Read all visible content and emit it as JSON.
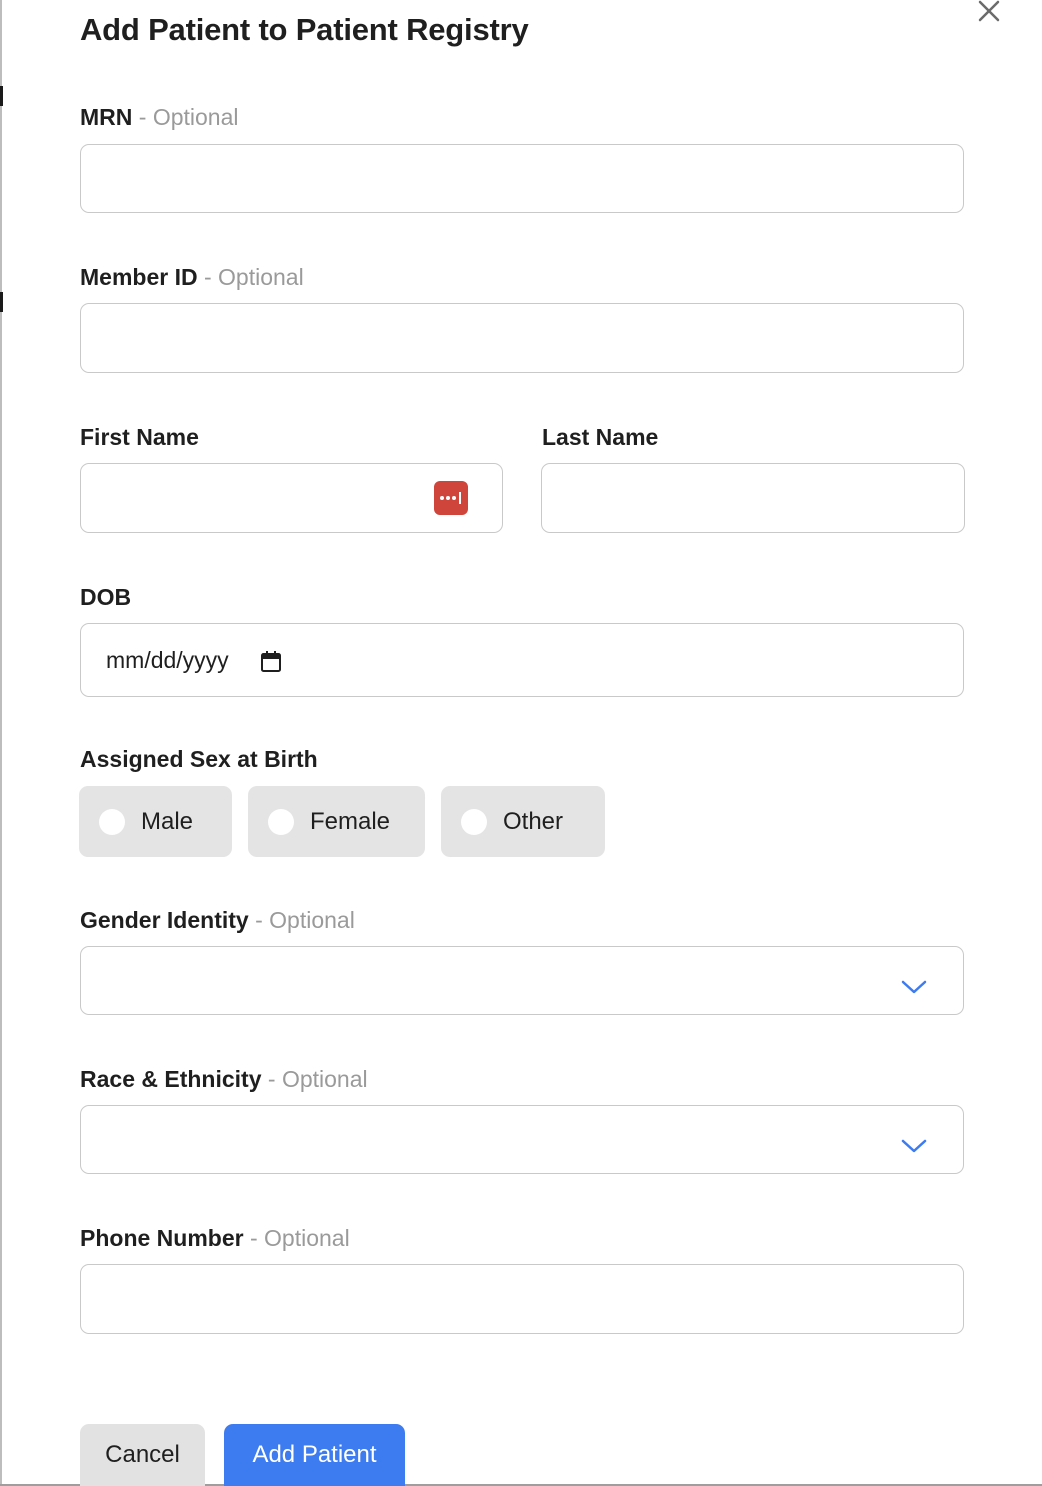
{
  "dialog": {
    "title": "Add Patient to Patient Registry",
    "close_icon": "close-icon"
  },
  "fields": {
    "optional_suffix": "- Optional",
    "mrn": {
      "label": "MRN",
      "value": ""
    },
    "member_id": {
      "label": "Member ID",
      "value": ""
    },
    "first_name": {
      "label": "First Name",
      "value": "",
      "autofill_icon": "password-manager-icon"
    },
    "last_name": {
      "label": "Last Name",
      "value": ""
    },
    "dob": {
      "label": "DOB",
      "placeholder": "mm/dd/yyyy",
      "icon": "calendar-icon"
    },
    "sex_at_birth": {
      "label": "Assigned Sex at Birth",
      "options": [
        "Male",
        "Female",
        "Other"
      ],
      "selected": null
    },
    "gender_identity": {
      "label": "Gender Identity",
      "value": "",
      "icon": "chevron-down-icon"
    },
    "race_ethnicity": {
      "label": "Race & Ethnicity",
      "value": "",
      "icon": "chevron-down-icon"
    },
    "phone": {
      "label": "Phone Number",
      "value": ""
    }
  },
  "actions": {
    "cancel_label": "Cancel",
    "submit_label": "Add Patient"
  },
  "colors": {
    "primary": "#3d7bf0",
    "pill_bg": "#e4e4e4",
    "optional_text": "#9a9a9a",
    "chevron": "#3d7bf0",
    "password_manager": "#d0453b"
  }
}
